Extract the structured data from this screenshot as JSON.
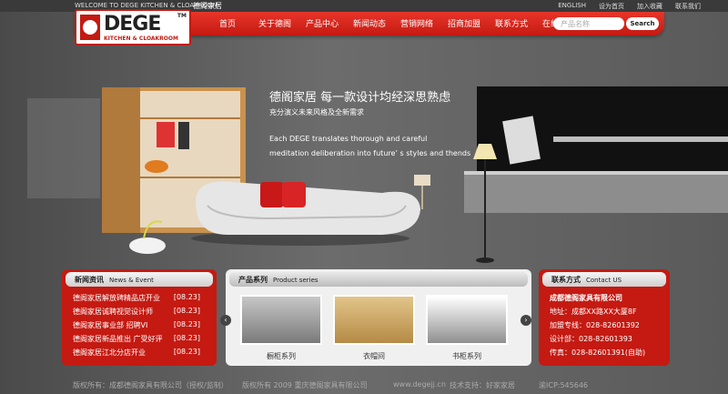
{
  "topbar": {
    "welcome": "WELCOME TO DEGE KITCHEN & CLOAKROOM",
    "welcome_cn": "德阁家居",
    "links": [
      "ENGLISH",
      "设为首页",
      "加入收藏",
      "联系我们"
    ]
  },
  "logo": {
    "word": "DEGE",
    "tm": "TM",
    "sub": "KITCHEN & CLOAKROOM"
  },
  "nav": [
    "首页",
    "关于德阁",
    "产品中心",
    "新闻动态",
    "营销网络",
    "招商加盟",
    "联系方式",
    "在线留言"
  ],
  "search": {
    "placeholder": "产品名称",
    "button": "Search"
  },
  "hero": {
    "title": "德阁家居  每一款设计均经深思熟虑",
    "subtitle": "充分演义未来风格及全新需求",
    "en_line1": "Each DEGE translates thorough and careful",
    "en_line2": "meditation deliberation into future’ s styles and thends"
  },
  "news": {
    "title": "新闻资讯",
    "title_en": "News & Event",
    "items": [
      {
        "text": "德阁家居解放碑精品店开业",
        "date": "[08.23]"
      },
      {
        "text": "德阁家居诚聘视觉设计师",
        "date": "[08.23]"
      },
      {
        "text": "德阁家居事业部 招聘VI",
        "date": "[08.23]"
      },
      {
        "text": "德阁家居新品推出 广受好评",
        "date": "[08.23]"
      },
      {
        "text": "德阁家居江北分店开业",
        "date": "[08.23]"
      }
    ]
  },
  "products": {
    "title": "产品系列",
    "title_en": "Product series",
    "items": [
      "橱柜系列",
      "衣帽间",
      "书柜系列"
    ],
    "prev": "‹",
    "next": "›"
  },
  "contact": {
    "title": "联系方式",
    "title_en": "Contact US",
    "company": "成都德阁家具有限公司",
    "address": "地址：成都XX路XX大厦8F",
    "hotline": "加盟专线：028-82601392",
    "designer": "设计部：028-82601393",
    "fax": "传真：028-82601391(自助)"
  },
  "footer": {
    "left": "版权所有：成都德阁家具有限公司（授权/监制）",
    "middle": "版权所有 2009 重庆德阁家具有限公司",
    "site": "www.degejj.cn",
    "tech": "技术支持：好家家居",
    "icp": "渝ICP:545646"
  },
  "colors": {
    "accent": "#c41a12",
    "nav_red": "#e8352a"
  }
}
